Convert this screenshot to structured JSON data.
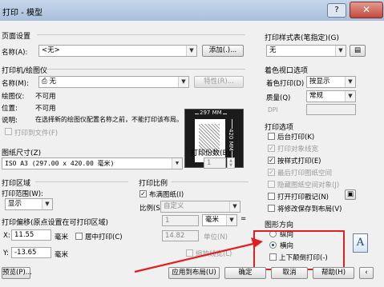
{
  "window": {
    "title": "打印 - 模型",
    "help_glyph": "?",
    "close_glyph": "✕"
  },
  "page_setup": {
    "header": "页面设置",
    "name_label": "名称(A):",
    "name_value": "<无>",
    "add_button": "添加(.)..."
  },
  "plotter": {
    "header": "打印机/绘图仪",
    "name_label": "名称(M):",
    "name_value": "无",
    "properties_button": "特性(R)...",
    "plotter_label": "绘图仪:",
    "plotter_value": "不可用",
    "location_label": "位置:",
    "location_value": "不可用",
    "description_label": "说明:",
    "description_value": "在选择新的绘图仪配置名称之前，不能打印该布局。",
    "print_to_file_label": "打印到文件(F)",
    "preview_dim_top": "297 MM",
    "preview_dim_side": "420 MM"
  },
  "paper_size": {
    "header": "图纸尺寸(Z)",
    "value": "ISO A3 (297.00 x 420.00 毫米)"
  },
  "copies": {
    "header": "打印份数(B)",
    "value": "1"
  },
  "plot_area": {
    "header": "打印区域",
    "what_label": "打印范围(W):",
    "what_value": "显示"
  },
  "plot_scale": {
    "header": "打印比例",
    "fit_label": "布满图纸(I)",
    "scale_label": "比例(S):",
    "scale_value": "自定义",
    "value1": "1",
    "unit": "毫米",
    "equals": "=",
    "value2": "14.82",
    "unit2": "单位(N)",
    "lineweights_label": "缩放线宽(L)"
  },
  "plot_offset": {
    "header": "打印偏移(原点设置在可打印区域)",
    "x_label": "X:",
    "x_value": "11.55",
    "x_unit": "毫米",
    "center_label": "居中打印(C)",
    "y_label": "Y:",
    "y_value": "-13.65",
    "y_unit": "毫米"
  },
  "plot_style": {
    "header": "打印样式表(笔指定)(G)",
    "value": "无"
  },
  "shaded_viewport": {
    "header": "着色视口选项",
    "shade_label": "着色打印(D)",
    "shade_value": "按显示",
    "quality_label": "质量(Q)",
    "quality_value": "常规",
    "dpi_label": "DPI"
  },
  "plot_options": {
    "header": "打印选项",
    "items": [
      {
        "label": "后台打印(K)",
        "checked": false,
        "disabled": false
      },
      {
        "label": "打印对象线宽",
        "checked": true,
        "disabled": true
      },
      {
        "label": "按样式打印(E)",
        "checked": true,
        "disabled": false
      },
      {
        "label": "最后打印图纸空间",
        "checked": true,
        "disabled": true
      },
      {
        "label": "隐藏图纸空间对象(J)",
        "checked": false,
        "disabled": true
      },
      {
        "label": "打开打印戳记(N)",
        "checked": false,
        "disabled": false
      },
      {
        "label": "将修改保存到布局(V)",
        "checked": false,
        "disabled": false
      }
    ]
  },
  "orientation": {
    "header": "图形方向",
    "portrait_label": "纵向",
    "landscape_label": "横向",
    "upside_down_label": "上下颠倒打印(-)",
    "selected": "landscape",
    "icon_glyph": "A"
  },
  "footer": {
    "preview_button": "预览(P)...",
    "apply_button": "应用到布局(U)",
    "ok_button": "确定",
    "cancel_button": "取消",
    "help_button": "帮助(H)",
    "expand_glyph": "‹"
  },
  "colors": {
    "highlight_box": "#e02020",
    "arrow": "#e02020"
  }
}
